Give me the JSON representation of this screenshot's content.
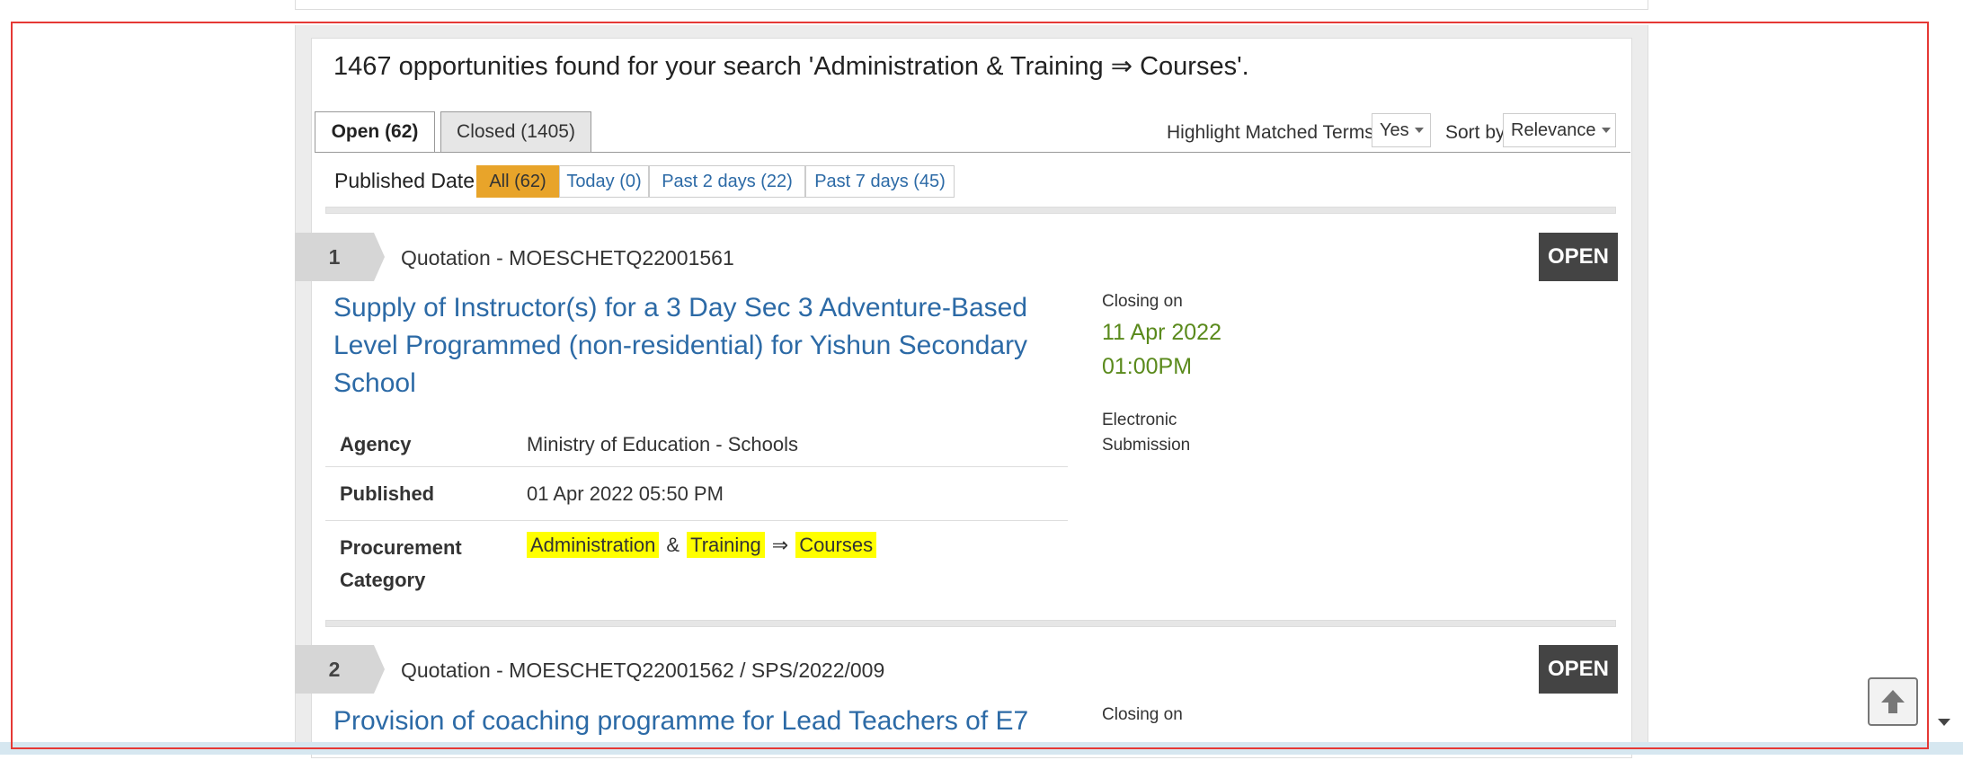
{
  "search": {
    "summary": "1467 opportunities found for your search 'Administration & Training ⇒ Courses'."
  },
  "tabs": [
    {
      "label": "Open (62)",
      "active": true
    },
    {
      "label": "Closed (1405)",
      "active": false
    }
  ],
  "controls": {
    "highlight_label": "Highlight Matched Terms",
    "highlight_value": "Yes",
    "sort_label": "Sort by",
    "sort_value": "Relevance"
  },
  "published_filter": {
    "label": "Published Date:",
    "options": [
      {
        "label": "All (62)",
        "selected": true
      },
      {
        "label": "Today (0)",
        "selected": false
      },
      {
        "label": "Past 2 days (22)",
        "selected": false
      },
      {
        "label": "Past 7 days (45)",
        "selected": false
      }
    ]
  },
  "results": [
    {
      "number": "1",
      "reference": "Quotation - MOESCHETQ22001561",
      "status": "OPEN",
      "title": "Supply of Instructor(s) for a 3 Day Sec 3 Adventure-Based Level Programmed (non-residential) for Yishun Secondary School",
      "agency_label": "Agency",
      "agency": "Ministry of Education - Schools",
      "published_label": "Published",
      "published": "01 Apr 2022 05:50 PM",
      "category_label": "Procurement Category",
      "category_terms": [
        "Administration",
        "&",
        "Training",
        "⇒",
        "Courses"
      ],
      "closing_label": "Closing on",
      "closing_date": "11 Apr 2022",
      "closing_time": "01:00PM",
      "submission": "Electronic Submission"
    },
    {
      "number": "2",
      "reference": "Quotation - MOESCHETQ22001562 / SPS/2022/009",
      "status": "OPEN",
      "title": "Provision of coaching programme for Lead Teachers of E7",
      "closing_label": "Closing on"
    }
  ],
  "colors": {
    "link": "#2c6aa6",
    "highlight": "#ffff00",
    "selected_filter": "#e8a42a",
    "status_badge": "#444444",
    "closing_date": "#5a8a1c",
    "frame": "#e53935"
  },
  "icons": {
    "scroll_top": "arrow-up-icon",
    "scroll_down": "caret-down-icon"
  }
}
